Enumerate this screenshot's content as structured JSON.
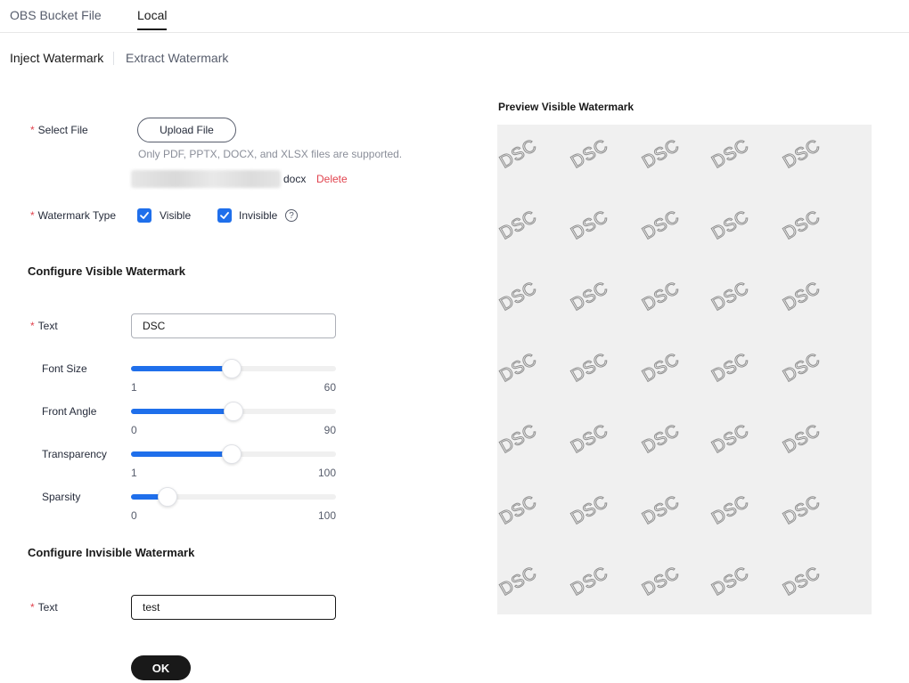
{
  "top_tabs": [
    {
      "label": "OBS Bucket File",
      "active": false
    },
    {
      "label": "Local",
      "active": true
    }
  ],
  "sub_tabs": [
    {
      "label": "Inject Watermark",
      "active": true
    },
    {
      "label": "Extract Watermark",
      "active": false
    }
  ],
  "form": {
    "required_mark": "*",
    "select_file_label": "Select File",
    "upload_button": "Upload File",
    "upload_hint": "Only PDF, PPTX, DOCX, and XLSX files are supported.",
    "file_extension": "docx",
    "delete_label": "Delete",
    "watermark_type_label": "Watermark Type",
    "visible_option": "Visible",
    "invisible_option": "Invisible",
    "help_glyph": "?",
    "visible_checked": true,
    "invisible_checked": true
  },
  "visible_section": {
    "title": "Configure Visible Watermark",
    "text_label": "Text",
    "text_value": "DSC",
    "sliders": [
      {
        "label": "Font Size",
        "min": "1",
        "max": "60",
        "fraction": 0.49
      },
      {
        "label": "Front Angle",
        "min": "0",
        "max": "90",
        "fraction": 0.5
      },
      {
        "label": "Transparency",
        "min": "1",
        "max": "100",
        "fraction": 0.49
      },
      {
        "label": "Sparsity",
        "min": "0",
        "max": "100",
        "fraction": 0.18
      }
    ]
  },
  "invisible_section": {
    "title": "Configure Invisible Watermark",
    "text_label": "Text",
    "text_value": "test"
  },
  "ok_button": "OK",
  "preview": {
    "title": "Preview Visible Watermark",
    "watermark_text": "DSC"
  },
  "colors": {
    "accent": "#1f6feb",
    "required": "#e1434e",
    "primary_button": "#191919",
    "preview_background": "#f0f0f0"
  }
}
